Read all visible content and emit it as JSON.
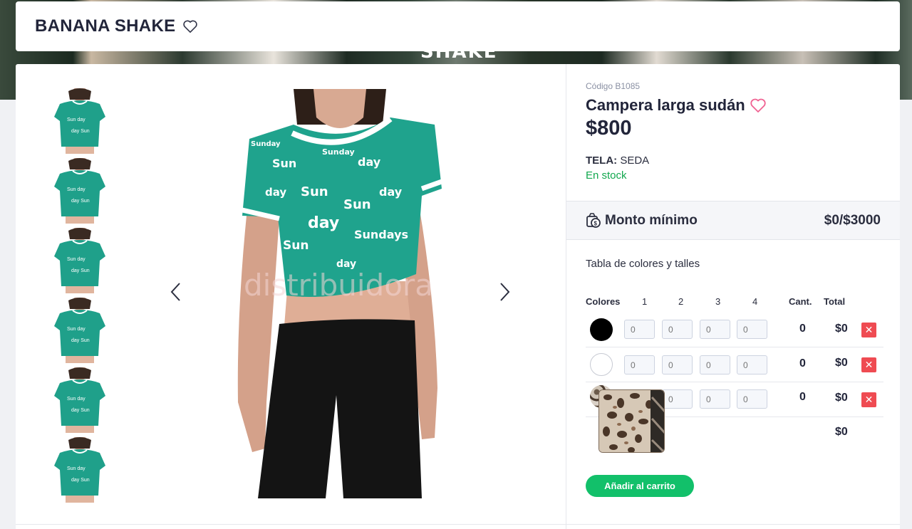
{
  "banner": {
    "word": "SHAKE"
  },
  "store": {
    "title": "BANANA SHAKE"
  },
  "gallery": {
    "thumbnails": [
      "thumb-1",
      "thumb-2",
      "thumb-3",
      "thumb-4",
      "thumb-5",
      "thumb-6"
    ],
    "watermark": "distribuidora"
  },
  "product": {
    "code": "Código B1085",
    "name": "Campera larga sudán",
    "price": "$800",
    "fabric_label": "TELA:",
    "fabric_value": "SEDA",
    "stock": "En stock"
  },
  "minimum": {
    "label": "Monto mínimo",
    "value": "$0/$3000"
  },
  "table": {
    "title": "Tabla de colores y talles",
    "headers": {
      "colors": "Colores",
      "sizes": [
        "1",
        "2",
        "3",
        "4"
      ],
      "qty": "Cant.",
      "total": "Total"
    },
    "rows": [
      {
        "swatch": "#000000",
        "inputs": [
          "0",
          "0",
          "0",
          "0"
        ],
        "qty": "0",
        "total": "$0",
        "delete": "✕"
      },
      {
        "swatch": "#ffffff",
        "inputs": [
          "0",
          "0",
          "0",
          "0"
        ],
        "qty": "0",
        "total": "$0",
        "delete": "✕"
      },
      {
        "swatch": "leopard",
        "inputs": [
          "0",
          "0",
          "0",
          "0"
        ],
        "qty": "0",
        "total": "$0",
        "delete": "✕"
      }
    ],
    "grand_total": "$0"
  },
  "cart": {
    "add_label": "Añadir al carrito"
  },
  "colors": {
    "accent_green": "#12c06a",
    "delete_red": "#ef4b52",
    "heart_pink": "#f06292",
    "stock_green": "#12a84e"
  }
}
